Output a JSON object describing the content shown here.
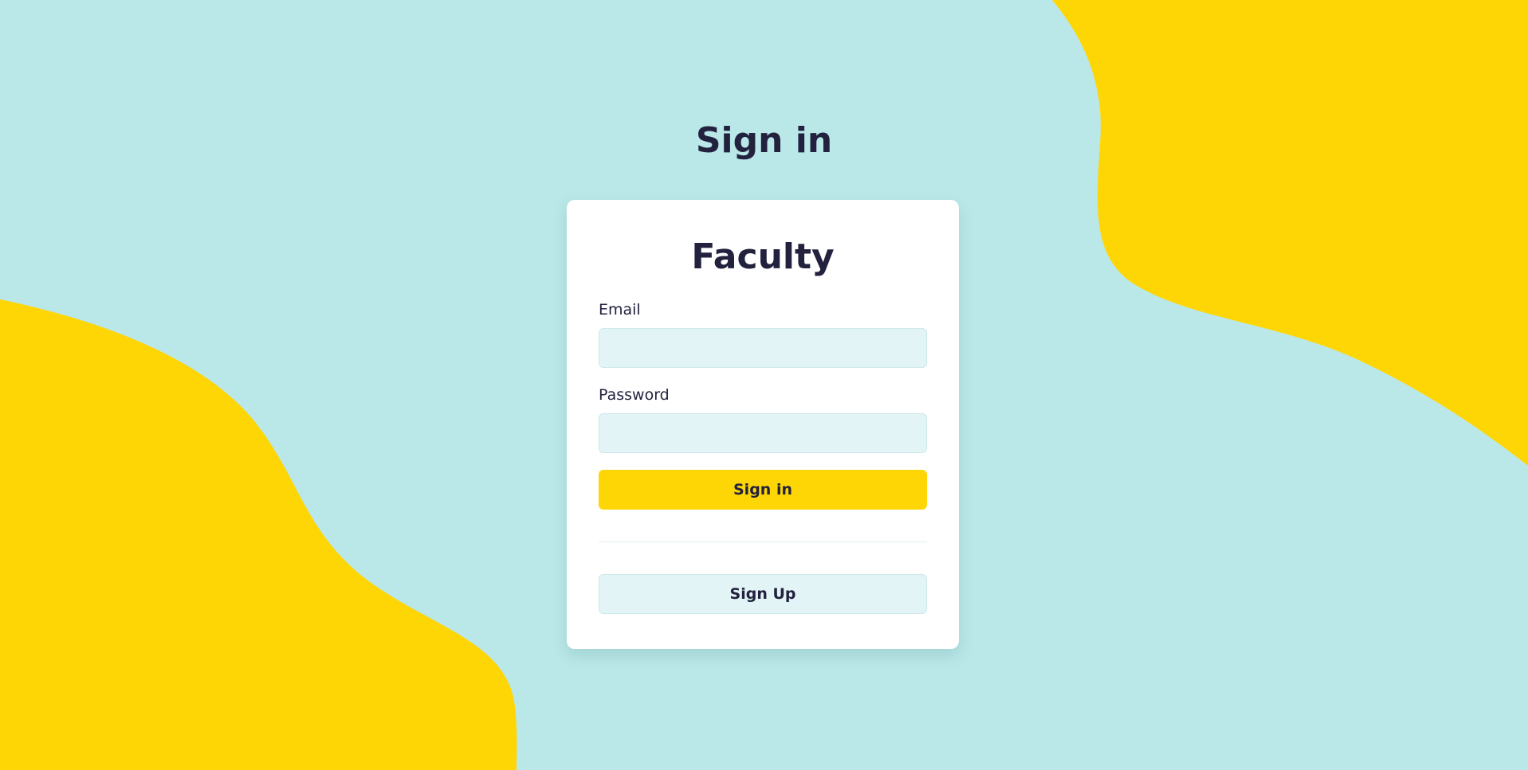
{
  "page": {
    "title": "Sign in"
  },
  "card": {
    "title": "Faculty",
    "email": {
      "label": "Email",
      "value": "",
      "placeholder": ""
    },
    "password": {
      "label": "Password",
      "value": "",
      "placeholder": ""
    },
    "signin_button": "Sign in",
    "signup_button": "Sign Up"
  },
  "colors": {
    "background": "#bae7e8",
    "accent": "#ffd605",
    "text": "#22223f",
    "input_fill": "#e2f4f5",
    "card": "#ffffff"
  }
}
